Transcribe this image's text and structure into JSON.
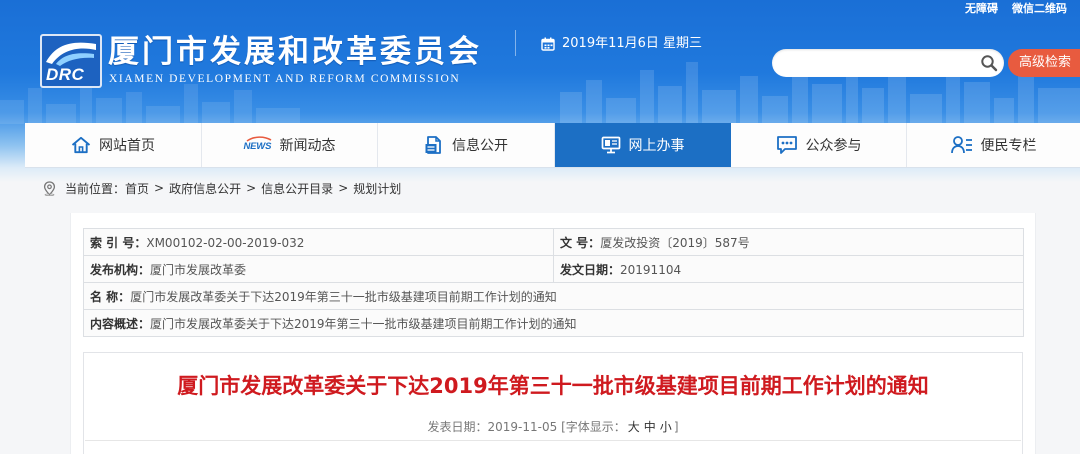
{
  "header": {
    "top_links": [
      {
        "label": "无障碍"
      },
      {
        "label": "微信二维码"
      }
    ],
    "logo_text": "DRC",
    "title": "厦门市发展和改革委员会",
    "subtitle": "XIAMEN DEVELOPMENT AND REFORM COMMISSION",
    "date_icon": "calendar-icon",
    "date": "2019年11月6日 星期三",
    "search": {
      "icon": "search-icon",
      "advanced_button": "高级检索"
    }
  },
  "nav": {
    "active_index": 3,
    "items": [
      {
        "label": "网站首页",
        "icon": "home-icon"
      },
      {
        "label": "新闻动态",
        "icon": "news-icon",
        "icon_text": "NEWS"
      },
      {
        "label": "信息公开",
        "icon": "document-icon"
      },
      {
        "label": "网上办事",
        "icon": "monitor-icon"
      },
      {
        "label": "公众参与",
        "icon": "chat-icon"
      },
      {
        "label": "便民专栏",
        "icon": "user-list-icon"
      }
    ]
  },
  "breadcrumb": {
    "icon": "location-icon",
    "prefix": "当前位置：",
    "separator": ">",
    "items": [
      "首页",
      "政府信息公开",
      "信息公开目录",
      "规划计划"
    ]
  },
  "info_table": {
    "rows": [
      [
        {
          "label": "索 引 号：",
          "value": "XM00102-02-00-2019-032"
        },
        {
          "label": "文 号：",
          "value": "厦发改投资〔2019〕587号"
        }
      ],
      [
        {
          "label": "发布机构：",
          "value": "厦门市发展改革委"
        },
        {
          "label": "发文日期：",
          "value": "20191104"
        }
      ],
      [
        {
          "label": "名 称：",
          "value": "厦门市发展改革委关于下达2019年第三十一批市级基建项目前期工作计划的通知"
        }
      ],
      [
        {
          "label": "内容概述：",
          "value": "厦门市发展改革委关于下达2019年第三十一批市级基建项目前期工作计划的通知"
        }
      ]
    ]
  },
  "article": {
    "title": "厦门市发展改革委关于下达2019年第三十一批市级基建项目前期工作计划的通知",
    "date_label": "发表日期：",
    "date": "2019-11-05",
    "font_size_label": "[字体显示：",
    "font_sizes": [
      "大",
      "中",
      "小"
    ],
    "font_size_close": "]"
  },
  "colors": {
    "header_blue": "#1a6fd6",
    "nav_active": "#1c6fc4",
    "title_red": "#cf1a1f",
    "search_button": "#e85b3f"
  }
}
